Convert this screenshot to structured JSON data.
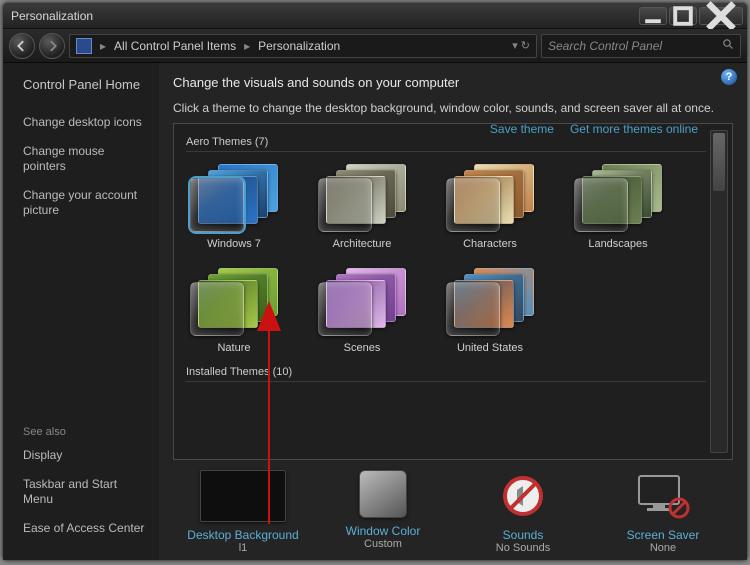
{
  "window": {
    "title": "Personalization"
  },
  "breadcrumb": {
    "root_icon": "control-panel-icon",
    "item1": "All Control Panel Items",
    "item2": "Personalization"
  },
  "search": {
    "placeholder": "Search Control Panel"
  },
  "sidebar": {
    "home": "Control Panel Home",
    "links": [
      "Change desktop icons",
      "Change mouse pointers",
      "Change your account picture"
    ],
    "see_also_header": "See also",
    "see_also": [
      "Display",
      "Taskbar and Start Menu",
      "Ease of Access Center"
    ]
  },
  "main": {
    "heading": "Change the visuals and sounds on your computer",
    "sub": "Click a theme to change the desktop background, window color, sounds, and screen saver all at once.",
    "save_theme": "Save theme",
    "get_more": "Get more themes online",
    "group_aero": "Aero Themes (7)",
    "group_installed": "Installed Themes (10)",
    "themes_aero": [
      {
        "name": "Windows 7",
        "selected": true,
        "colors": [
          "#2b74c7",
          "#4aa3e0",
          "#1a4070"
        ]
      },
      {
        "name": "Architecture",
        "selected": false,
        "colors": [
          "#cfd3c2",
          "#8b8a72",
          "#4d4a3a"
        ]
      },
      {
        "name": "Characters",
        "selected": false,
        "colors": [
          "#e8dfb0",
          "#c1844a",
          "#8a5a2e"
        ]
      },
      {
        "name": "Landscapes",
        "selected": false,
        "colors": [
          "#6b8050",
          "#a8b890",
          "#3a4a30"
        ]
      },
      {
        "name": "Nature",
        "selected": false,
        "colors": [
          "#a6c84a",
          "#6aa034",
          "#3a6018"
        ]
      },
      {
        "name": "Scenes",
        "selected": false,
        "colors": [
          "#e0b8e8",
          "#b070c0",
          "#704090"
        ]
      },
      {
        "name": "United States",
        "selected": false,
        "colors": [
          "#e08850",
          "#5090c0",
          "#304860"
        ]
      }
    ]
  },
  "settings": {
    "desktop_bg": {
      "label": "Desktop Background",
      "value": "l1"
    },
    "window_color": {
      "label": "Window Color",
      "value": "Custom"
    },
    "sounds": {
      "label": "Sounds",
      "value": "No Sounds"
    },
    "screen_saver": {
      "label": "Screen Saver",
      "value": "None"
    }
  }
}
